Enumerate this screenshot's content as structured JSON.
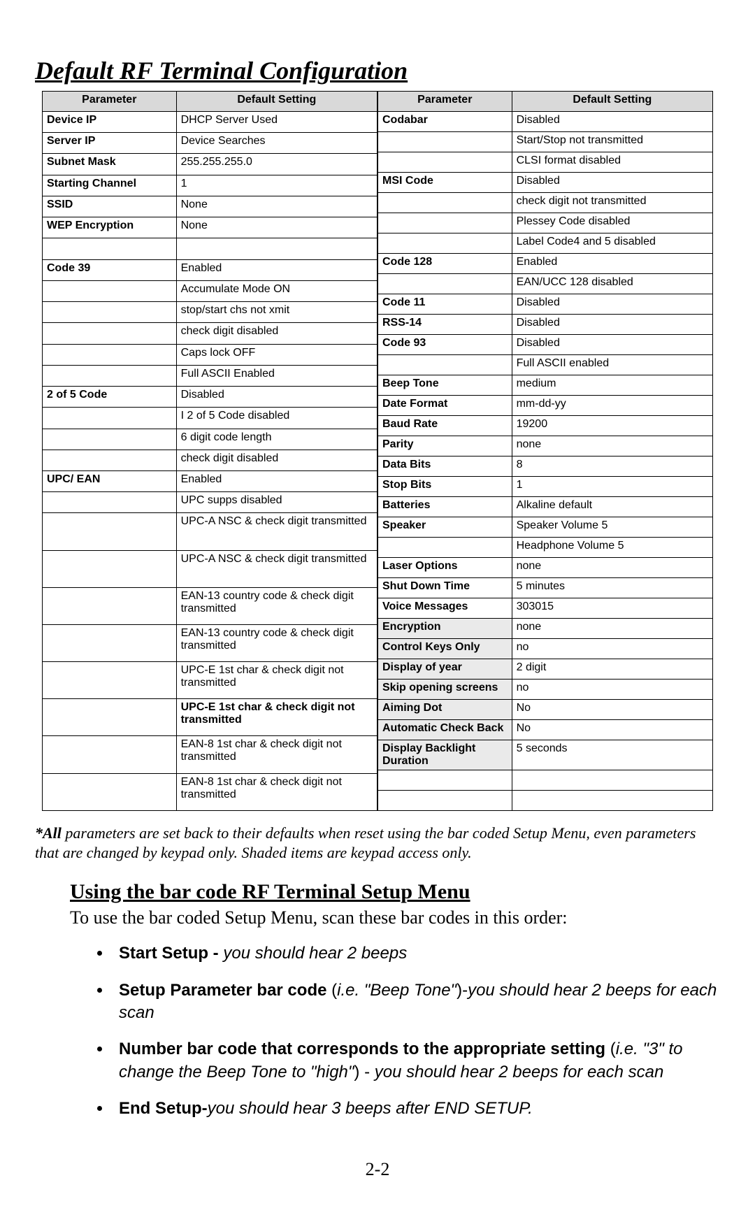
{
  "heading1": "Default RF Terminal Configuration",
  "headers": {
    "param": "Parameter",
    "def": "Default Setting"
  },
  "left": [
    {
      "p": "Device IP",
      "pb": true,
      "d": "DHCP Server Used"
    },
    {
      "p": "Server IP",
      "pb": true,
      "d": "Device Searches"
    },
    {
      "p": "Subnet Mask",
      "pb": true,
      "d": "255.255.255.0"
    },
    {
      "p": "Starting Channel",
      "pb": true,
      "d": "1"
    },
    {
      "p": "SSID",
      "pb": true,
      "d": "None"
    },
    {
      "p": "WEP Encryption",
      "pb": true,
      "d": "None"
    },
    {
      "p": "",
      "d": ""
    },
    {
      "p": "Code 39",
      "pb": true,
      "d": "Enabled"
    },
    {
      "p": "",
      "d": "Accumulate Mode ON"
    },
    {
      "p": "",
      "d": "stop/start chs not xmit"
    },
    {
      "p": "",
      "d": "check digit disabled"
    },
    {
      "p": "",
      "d": "Caps lock OFF"
    },
    {
      "p": "",
      "d": "Full ASCII Enabled"
    },
    {
      "p": "2 of 5 Code",
      "pb": true,
      "d": "Disabled"
    },
    {
      "p": "",
      "d": "I 2 of 5 Code disabled"
    },
    {
      "p": "",
      "d": "6 digit code length"
    },
    {
      "p": "",
      "d": "check digit disabled"
    },
    {
      "p": "UPC/ EAN",
      "pb": true,
      "d": "Enabled"
    },
    {
      "p": "",
      "d": "UPC supps disabled"
    },
    {
      "p": "",
      "d": "UPC-A NSC & check digit transmitted",
      "tall": true
    },
    {
      "p": "",
      "d": "UPC-A NSC & check digit transmitted",
      "tall": true
    },
    {
      "p": "",
      "d": "EAN-13 country code & check digit transmitted",
      "tall": true
    },
    {
      "p": "",
      "d": "EAN-13 country code & check digit transmitted",
      "tall": true
    },
    {
      "p": "",
      "d": "UPC-E 1st char & check digit not transmitted",
      "tall": true
    },
    {
      "p": "",
      "d": "UPC-E 1st char & check digit not transmitted",
      "db": true,
      "tall": true
    },
    {
      "p": "",
      "d": "EAN-8 1st char & check digit not transmitted",
      "tall": true
    },
    {
      "p": "",
      "d": "EAN-8 1st char & check digit not transmitted",
      "tall": true
    }
  ],
  "right": [
    {
      "p": "Codabar",
      "pb": true,
      "d": "Disabled"
    },
    {
      "p": "",
      "d": "Start/Stop not transmitted"
    },
    {
      "p": "",
      "d": "CLSI format disabled"
    },
    {
      "p": "MSI Code",
      "pb": true,
      "d": "Disabled"
    },
    {
      "p": "",
      "d": "check digit not transmitted"
    },
    {
      "p": "",
      "d": "Plessey Code disabled"
    },
    {
      "p": "",
      "d": "Label Code4 and 5 disabled"
    },
    {
      "p": "Code 128",
      "pb": true,
      "d": "Enabled"
    },
    {
      "p": "",
      "d": "EAN/UCC 128 disabled"
    },
    {
      "p": "Code 11",
      "pb": true,
      "d": "Disabled"
    },
    {
      "p": "RSS-14",
      "pb": true,
      "d": "Disabled"
    },
    {
      "p": "Code 93",
      "pb": true,
      "d": "Disabled"
    },
    {
      "p": "",
      "d": "Full ASCII enabled"
    },
    {
      "p": "Beep Tone",
      "pb": true,
      "d": "medium"
    },
    {
      "p": "Date Format",
      "pb": true,
      "d": "mm-dd-yy"
    },
    {
      "p": "Baud Rate",
      "pb": true,
      "d": "19200"
    },
    {
      "p": "Parity",
      "pb": true,
      "d": "none"
    },
    {
      "p": "Data Bits",
      "pb": true,
      "d": "8"
    },
    {
      "p": "Stop Bits",
      "pb": true,
      "d": "1"
    },
    {
      "p": "Batteries",
      "pb": true,
      "d": "Alkaline default"
    },
    {
      "p": "Speaker",
      "pb": true,
      "d": "Speaker Volume 5"
    },
    {
      "p": "",
      "d": "Headphone Volume 5"
    },
    {
      "p": "Laser Options",
      "pb": true,
      "d": "none"
    },
    {
      "p": "Shut Down Time",
      "pb": true,
      "d": "5 minutes"
    },
    {
      "p": "Voice Messages",
      "pb": true,
      "d": "303015"
    },
    {
      "p": "Encryption",
      "pb": true,
      "d": "none",
      "sh": true
    },
    {
      "p": "Control Keys Only",
      "pb": true,
      "d": "no",
      "sh": true
    },
    {
      "p": "Display of year",
      "pb": true,
      "d": "2 digit",
      "sh": true
    },
    {
      "p": "Skip opening screens",
      "pb": true,
      "d": "no",
      "sh": true
    },
    {
      "p": "Aiming Dot",
      "pb": true,
      "d": "No",
      "sh": true
    },
    {
      "p": "Automatic Check Back",
      "pb": true,
      "d": "No",
      "sh": true
    },
    {
      "p": "Display Backlight Duration",
      "pb": true,
      "d": "5 seconds",
      "sh": true
    },
    {
      "p": "",
      "d": ""
    },
    {
      "p": "",
      "d": ""
    }
  ],
  "note_prefix": "*All",
  "note_rest": " parameters are set back to their defaults when reset using the bar coded Setup Menu, even parameters that are changed by keypad only. Shaded items are keypad access only.",
  "heading2": "Using the bar code RF Terminal Setup Menu",
  "body1": "To use the bar coded Setup Menu, scan these bar codes in this order:",
  "bullets": {
    "b1_b": "Start Setup - ",
    "b1_i": "you should hear 2 beeps",
    "b2_b": "Setup Parameter bar code ",
    "b2_m": "(",
    "b2_i": "i.e. \"Beep Tone\"",
    "b2_m2": ")-",
    "b2_i2": "you should hear 2 beeps for each scan",
    "b3_b": "Number bar code that corresponds to the appropriate setting",
    "b3_m": " (",
    "b3_i": "i.e. \"3\" to change the Beep Tone to \"high\"",
    "b3_m2": ") - ",
    "b3_i2": "you should hear 2 beeps for each scan",
    "b4_b": "End Setup-",
    "b4_i": "you should hear 3 beeps after END SETUP."
  },
  "pagenum": "2-2"
}
